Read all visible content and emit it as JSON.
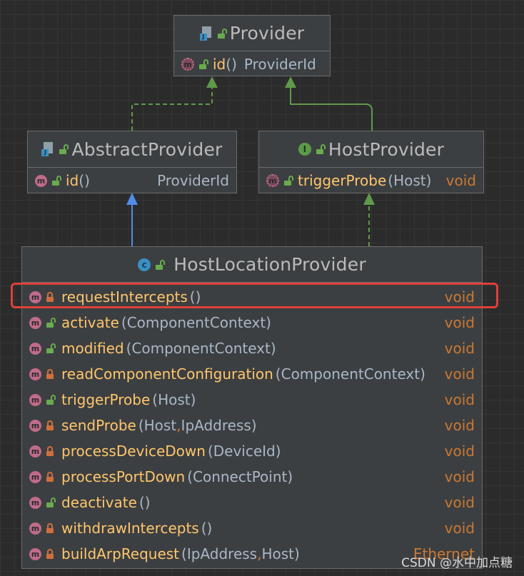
{
  "classes": {
    "provider": {
      "name": "Provider",
      "members": [
        {
          "name": "id",
          "params": "",
          "ret": "ProviderId"
        }
      ]
    },
    "abstract_provider": {
      "name": "AbstractProvider",
      "members": [
        {
          "name": "id",
          "params": "",
          "ret": "ProviderId"
        }
      ]
    },
    "host_provider": {
      "name": "HostProvider",
      "members": [
        {
          "name": "triggerProbe",
          "params": "Host",
          "ret": "void"
        }
      ]
    },
    "host_location_provider": {
      "name": "HostLocationProvider",
      "members": [
        {
          "name": "requestIntercepts",
          "p1": "",
          "p2": "",
          "ret": "void",
          "visibility": "private"
        },
        {
          "name": "activate",
          "p1": "ComponentContext",
          "p2": "",
          "ret": "void",
          "visibility": "public"
        },
        {
          "name": "modified",
          "p1": "ComponentContext",
          "p2": "",
          "ret": "void",
          "visibility": "public"
        },
        {
          "name": "readComponentConfiguration",
          "p1": "ComponentContext",
          "p2": "",
          "ret": "void",
          "visibility": "private"
        },
        {
          "name": "triggerProbe",
          "p1": "Host",
          "p2": "",
          "ret": "void",
          "visibility": "public"
        },
        {
          "name": "sendProbe",
          "p1": "Host",
          "p2": "IpAddress",
          "ret": "void",
          "visibility": "private"
        },
        {
          "name": "processDeviceDown",
          "p1": "DeviceId",
          "p2": "",
          "ret": "void",
          "visibility": "private"
        },
        {
          "name": "processPortDown",
          "p1": "ConnectPoint",
          "p2": "",
          "ret": "void",
          "visibility": "private"
        },
        {
          "name": "deactivate",
          "p1": "",
          "p2": "",
          "ret": "void",
          "visibility": "public"
        },
        {
          "name": "withdrawIntercepts",
          "p1": "",
          "p2": "",
          "ret": "void",
          "visibility": "private"
        },
        {
          "name": "buildArpRequest",
          "p1": "IpAddress",
          "p2": "Host",
          "ret": "Ethernet",
          "visibility": "private"
        }
      ]
    }
  },
  "icons": {
    "method": "m",
    "class": "c",
    "interface": "I"
  },
  "colors": {
    "background": "#2b2b2b",
    "method_name": "#ffc66d",
    "return_type": "#cc7832",
    "inherit_edge": "#4f8ee8",
    "implement_edge": "#5f9a4a",
    "highlight": "#e0403a"
  },
  "watermark": "CSDN @水中加点糖"
}
